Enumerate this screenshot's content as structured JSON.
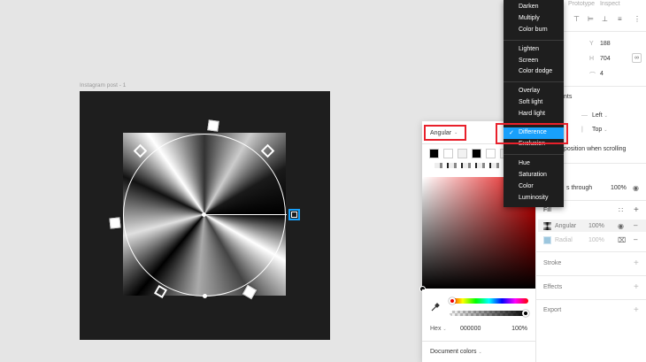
{
  "canvas": {
    "frame_label": "Instagram post - 1"
  },
  "picker": {
    "type_label": "Angular",
    "hex_label": "Hex",
    "hex_value": "000000",
    "alpha_value": "100%",
    "document_colors_label": "Document colors",
    "swatch_colors": [
      "#000000",
      "#ffffff",
      "#f0f0f0",
      "#000000",
      "#ffffff",
      "#f0f0f0",
      "#000000"
    ]
  },
  "blend_menu": {
    "items": [
      "Darken",
      "Multiply",
      "Color burn",
      "Lighten",
      "Screen",
      "Color dodge",
      "Overlay",
      "Soft light",
      "Hard light",
      "Difference",
      "Exclusion",
      "Hue",
      "Saturation",
      "Color",
      "Luminosity"
    ],
    "selected": "Difference"
  },
  "props": {
    "tabs": [
      "Prototype",
      "Inspect"
    ],
    "y_label": "Y",
    "y_value": "188",
    "h_label": "H",
    "h_value": "704",
    "radius_value": "4",
    "constraints_title": "nts",
    "h_constraint": "Left",
    "v_constraint": "Top",
    "fix_position_text": "position when scrolling",
    "layer_mode": "s through",
    "layer_opacity": "100%",
    "fill_title": "Fill",
    "fills": [
      {
        "name": "Angular",
        "opacity": "100%"
      },
      {
        "name": "Radial",
        "opacity": "100%"
      }
    ],
    "stroke_title": "Stroke",
    "effects_title": "Effects",
    "export_title": "Export"
  },
  "colors": {
    "accent": "#18a0fb",
    "highlight_red": "#e8202b",
    "frame_bg": "#1e1e1e",
    "menu_bg": "#1e1e1e"
  }
}
